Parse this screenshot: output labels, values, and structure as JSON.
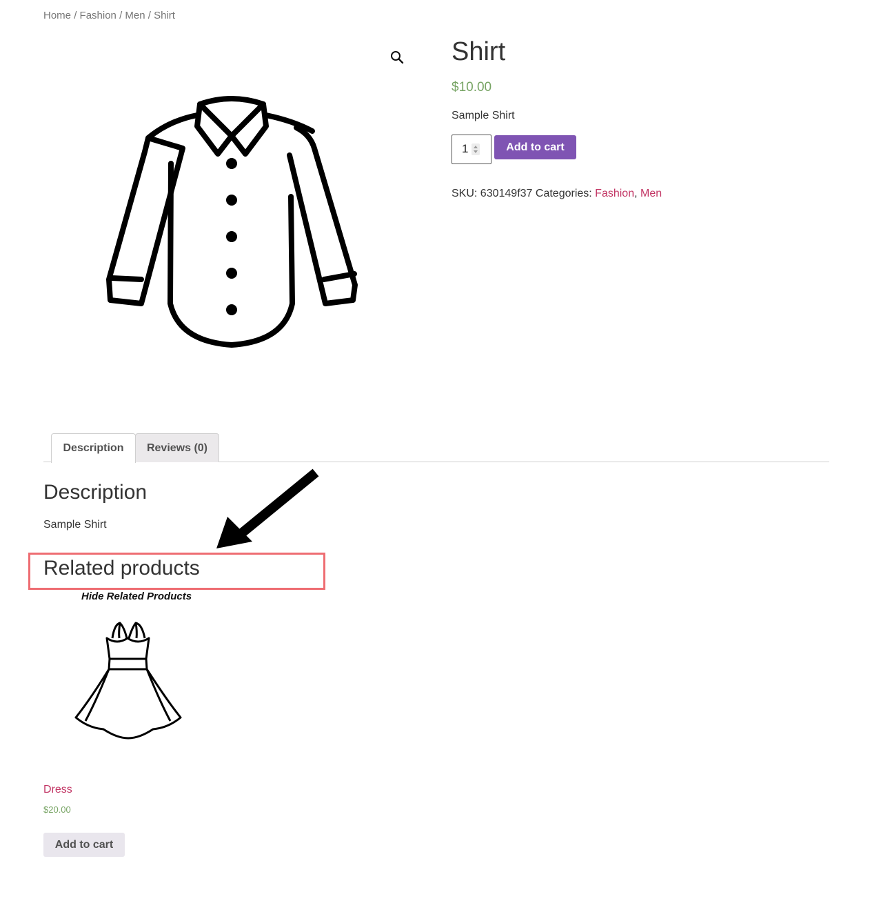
{
  "breadcrumb": {
    "home": "Home",
    "category": "Fashion",
    "subcategory": "Men",
    "current": "Shirt",
    "separator": "/"
  },
  "gallery": {
    "zoom_icon": "magnifier-icon",
    "image": "shirt-outline-icon"
  },
  "product": {
    "title": "Shirt",
    "price": "$10.00",
    "short_description": "Sample Shirt",
    "quantity": "1",
    "add_to_cart_label": "Add to cart",
    "sku_label": "SKU:",
    "sku_value": "630149f37",
    "categories_label": "Categories:",
    "categories": [
      "Fashion",
      "Men"
    ],
    "category_separator": ","
  },
  "tabs": [
    {
      "label": "Description",
      "active": true
    },
    {
      "label": "Reviews (0)",
      "active": false
    }
  ],
  "description": {
    "heading": "Description",
    "text": "Sample Shirt"
  },
  "related": {
    "heading": "Related products",
    "annotation": "Hide Related Products",
    "annotation_arrow_icon": "arrow-down-left-icon",
    "products": [
      {
        "image": "dress-outline-icon",
        "title": "Dress",
        "price": "$20.00",
        "button_label": "Add to cart"
      }
    ]
  },
  "colors": {
    "accent_button": "#7f54b3",
    "price": "#77a464",
    "link": "#c23564",
    "highlight": "#ee6d72"
  }
}
